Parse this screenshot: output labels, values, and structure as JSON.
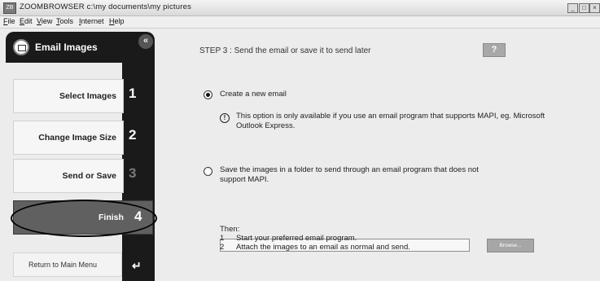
{
  "window": {
    "title": "ZOOMBROWSER c:\\my documents\\my pictures",
    "icon_text": "ZB"
  },
  "window_controls": {
    "minimize": "_",
    "maximize": "□",
    "close": "×"
  },
  "menu": [
    "File",
    "Edit",
    "View",
    "Tools",
    "Internet",
    "Help"
  ],
  "sidebar": {
    "title": "Email Images",
    "collapse_symbol": "«",
    "steps": [
      {
        "label": "Select Images",
        "number": "1"
      },
      {
        "label": "Change Image Size",
        "number": "2"
      },
      {
        "label": "Send or Save",
        "number": "3"
      },
      {
        "label": "Finish",
        "number": "4"
      }
    ],
    "return_label": "Return to Main Menu",
    "return_symbol": "↵"
  },
  "main": {
    "heading": "STEP 3 : Send the email or save it to send later",
    "help_label": "?",
    "option1": "Create a new email",
    "info_symbol": "!",
    "info_text": "This option is only available if you use an email program that supports MAPI, eg. Microsoft Outlook Express.",
    "option2": "Save the images in a folder to send through an email program that does not support MAPI.",
    "folder_value": "",
    "browse_label": "Browse...",
    "then_label": "Then:",
    "then_steps": [
      {
        "n": "1",
        "text": "Start your preferred email program."
      },
      {
        "n": "2",
        "text": "Attach the images to an email as normal and send."
      }
    ]
  },
  "colors": {
    "panel_dark": "#1a1a1a",
    "panel_light": "#ececec",
    "selected_card": "#606060"
  }
}
